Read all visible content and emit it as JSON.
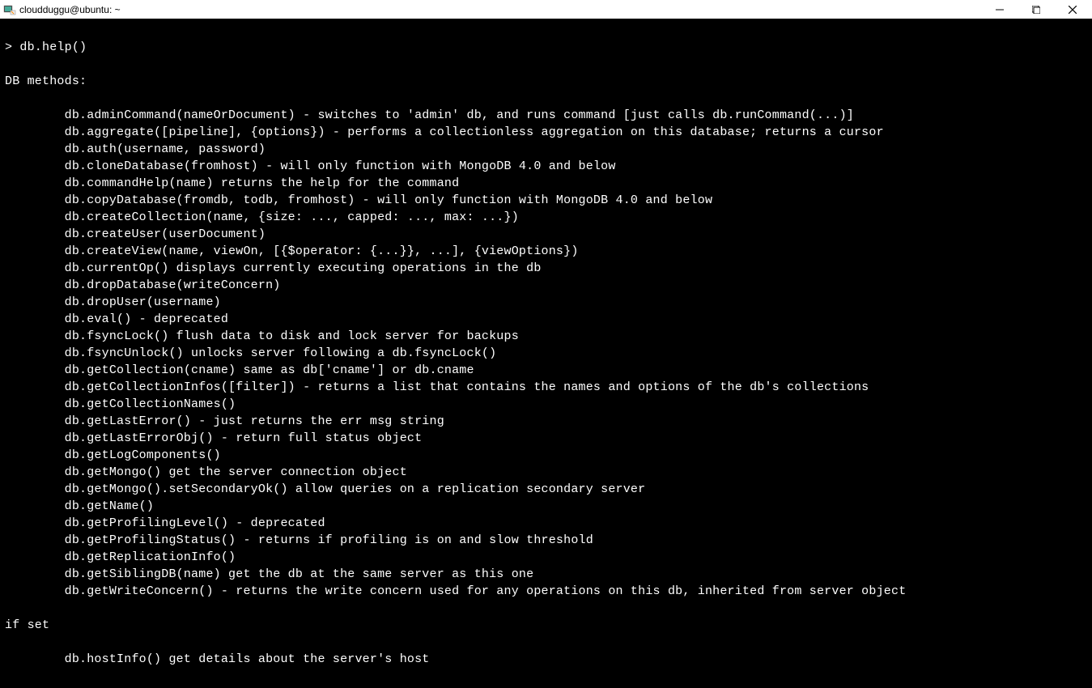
{
  "titlebar": {
    "title": "cloudduggu@ubuntu: ~"
  },
  "terminal": {
    "prompt": "> db.help()",
    "header": "DB methods:",
    "methods": [
      "db.adminCommand(nameOrDocument) - switches to 'admin' db, and runs command [just calls db.runCommand(...)]",
      "db.aggregate([pipeline], {options}) - performs a collectionless aggregation on this database; returns a cursor",
      "db.auth(username, password)",
      "db.cloneDatabase(fromhost) - will only function with MongoDB 4.0 and below",
      "db.commandHelp(name) returns the help for the command",
      "db.copyDatabase(fromdb, todb, fromhost) - will only function with MongoDB 4.0 and below",
      "db.createCollection(name, {size: ..., capped: ..., max: ...})",
      "db.createUser(userDocument)",
      "db.createView(name, viewOn, [{$operator: {...}}, ...], {viewOptions})",
      "db.currentOp() displays currently executing operations in the db",
      "db.dropDatabase(writeConcern)",
      "db.dropUser(username)",
      "db.eval() - deprecated",
      "db.fsyncLock() flush data to disk and lock server for backups",
      "db.fsyncUnlock() unlocks server following a db.fsyncLock()",
      "db.getCollection(cname) same as db['cname'] or db.cname",
      "db.getCollectionInfos([filter]) - returns a list that contains the names and options of the db's collections",
      "db.getCollectionNames()",
      "db.getLastError() - just returns the err msg string",
      "db.getLastErrorObj() - return full status object",
      "db.getLogComponents()",
      "db.getMongo() get the server connection object",
      "db.getMongo().setSecondaryOk() allow queries on a replication secondary server",
      "db.getName()",
      "db.getProfilingLevel() - deprecated",
      "db.getProfilingStatus() - returns if profiling is on and slow threshold",
      "db.getReplicationInfo()",
      "db.getSiblingDB(name) get the db at the same server as this one",
      "db.getWriteConcern() - returns the write concern used for any operations on this db, inherited from server object"
    ],
    "continuation": "if set",
    "last_method": "db.hostInfo() get details about the server's host"
  }
}
